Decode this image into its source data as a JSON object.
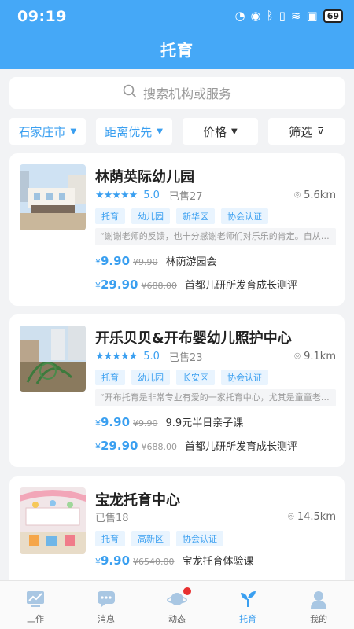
{
  "status_bar": {
    "time": "09:19",
    "battery": "69"
  },
  "header": {
    "title": "托育"
  },
  "search": {
    "placeholder": "搜索机构或服务"
  },
  "filters": [
    {
      "label": "石家庄市"
    },
    {
      "label": "距离优先"
    },
    {
      "label": "价格"
    },
    {
      "label": "筛选"
    }
  ],
  "listings": [
    {
      "name": "林荫英际幼儿园",
      "stars": "★★★★★",
      "score": "5.0",
      "sold": "已售27",
      "distance": "5.6km",
      "tags": [
        "托育",
        "幼儿园",
        "新华区",
        "协会认证"
      ],
      "review": "“谢谢老师的反馈，也十分感谢老师们对乐乐的肯定。自从…",
      "deals": [
        {
          "price": "9.90",
          "original": "¥9.90",
          "name": "林荫游园会"
        },
        {
          "price": "29.90",
          "original": "¥688.00",
          "name": "首都儿研所发育成长测评"
        }
      ]
    },
    {
      "name": "开乐贝贝&开布婴幼儿照护中心",
      "stars": "★★★★★",
      "score": "5.0",
      "sold": "已售23",
      "distance": "9.1km",
      "tags": [
        "托育",
        "幼儿园",
        "长安区",
        "协会认证"
      ],
      "review": "“开布托育是非常专业有爱的一家托育中心，尤其是童童老…",
      "deals": [
        {
          "price": "9.90",
          "original": "¥9.90",
          "name": "9.9元半日亲子课"
        },
        {
          "price": "29.90",
          "original": "¥688.00",
          "name": "首都儿研所发育成长测评"
        }
      ]
    },
    {
      "name": "宝龙托育中心",
      "sold": "已售18",
      "distance": "14.5km",
      "tags": [
        "托育",
        "高新区",
        "协会认证"
      ],
      "deals": [
        {
          "price": "9.90",
          "original": "¥6540.00",
          "name": "宝龙托育体验课"
        }
      ]
    }
  ],
  "nav": [
    {
      "label": "工作"
    },
    {
      "label": "消息"
    },
    {
      "label": "动态"
    },
    {
      "label": "托育"
    },
    {
      "label": "我的"
    }
  ],
  "colors": {
    "accent": "#3a9ff0",
    "header": "#45a8f7",
    "badge": "#e83030"
  }
}
